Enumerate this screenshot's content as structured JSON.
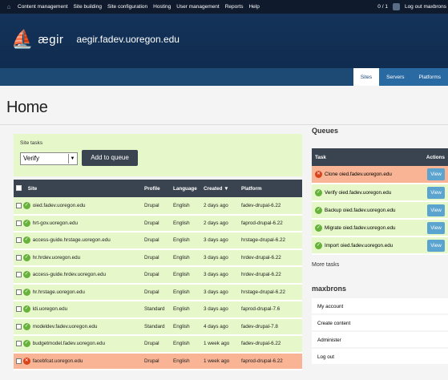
{
  "topbar": {
    "menu": [
      "Content management",
      "Site building",
      "Site configuration",
      "Hosting",
      "User management",
      "Reports",
      "Help"
    ],
    "counter": "0 / 1",
    "logout": "Log out maxbrons"
  },
  "header": {
    "logo_text": "ægir",
    "hostname": "aegir.fadev.uoregon.edu"
  },
  "subnav": {
    "tabs": [
      {
        "label": "Sites"
      },
      {
        "label": "Servers"
      },
      {
        "label": "Platforms"
      }
    ]
  },
  "page": {
    "title": "Home"
  },
  "site_tasks": {
    "label": "Site tasks",
    "selected": "Verify",
    "add_button": "Add to queue"
  },
  "sites_table": {
    "headers": [
      "Site",
      "Profile",
      "Language",
      "Created",
      "Platform"
    ],
    "rows": [
      {
        "site": "oied.fadev.uoregon.edu",
        "profile": "Drupal",
        "language": "English",
        "created": "2 days ago",
        "platform": "fadev-drupal-6.22",
        "status": "ok"
      },
      {
        "site": "hrt-gov.uoregon.edu",
        "profile": "Drupal",
        "language": "English",
        "created": "2 days ago",
        "platform": "faprod-drupal-6.22",
        "status": "ok"
      },
      {
        "site": "access-guide.hrstage.uoregon.edu",
        "profile": "Drupal",
        "language": "English",
        "created": "3 days ago",
        "platform": "hrstage-drupal-6.22",
        "status": "ok"
      },
      {
        "site": "hr.hrdev.uoregon.edu",
        "profile": "Drupal",
        "language": "English",
        "created": "3 days ago",
        "platform": "hrdev-drupal-6.22",
        "status": "ok"
      },
      {
        "site": "access-guide.hrdev.uoregon.edu",
        "profile": "Drupal",
        "language": "English",
        "created": "3 days ago",
        "platform": "hrdev-drupal-6.22",
        "status": "ok"
      },
      {
        "site": "hr.hrstage.uoregon.edu",
        "profile": "Drupal",
        "language": "English",
        "created": "3 days ago",
        "platform": "hrstage-drupal-6.22",
        "status": "ok"
      },
      {
        "site": "ldi.uoregon.edu",
        "profile": "Standard",
        "language": "English",
        "created": "3 days ago",
        "platform": "faprod-drupal-7.6",
        "status": "ok"
      },
      {
        "site": "modeldev.fadev.uoregon.edu",
        "profile": "Standard",
        "language": "English",
        "created": "4 days ago",
        "platform": "fadev-drupal-7.8",
        "status": "ok"
      },
      {
        "site": "budgetmodel.fadev.uoregon.edu",
        "profile": "Drupal",
        "language": "English",
        "created": "1 week ago",
        "platform": "fadev-drupal-6.22",
        "status": "ok"
      },
      {
        "site": "facebfcat.uoregon.edu",
        "profile": "Drupal",
        "language": "English",
        "created": "1 week ago",
        "platform": "faprod-drupal-6.22",
        "status": "err"
      }
    ]
  },
  "queues": {
    "title": "Queues",
    "headers": [
      "Task",
      "Actions"
    ],
    "rows": [
      {
        "task": "Clone oied.fadev.uoregon.edu",
        "action": "View",
        "status": "err"
      },
      {
        "task": "Verify oied.fadev.uoregon.edu",
        "action": "View",
        "status": "ok"
      },
      {
        "task": "Backup oied.fadev.uoregon.edu",
        "action": "View",
        "status": "ok"
      },
      {
        "task": "Migrate oied.fadev.uoregon.edu",
        "action": "View",
        "status": "ok"
      },
      {
        "task": "Import oied.fadev.uoregon.edu",
        "action": "View",
        "status": "ok"
      }
    ],
    "more": "More tasks"
  },
  "user_menu": {
    "title": "maxbrons",
    "links": [
      "My account",
      "Create content",
      "Administer",
      "Log out"
    ]
  },
  "colors": {
    "ok_row": "#e6f7c9",
    "err_row": "#f8b494",
    "header_bg": "#14335a",
    "table_head": "#3a4450",
    "view_btn": "#5ba4cf"
  }
}
